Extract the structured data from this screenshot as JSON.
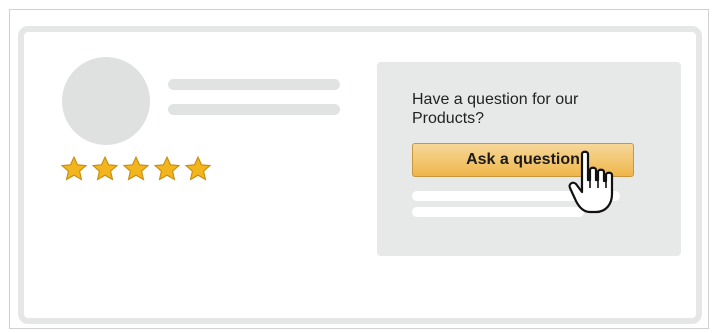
{
  "qa_panel": {
    "heading": "Have a question for our Products?",
    "ask_button_label": "Ask a question"
  },
  "rating": {
    "stars_filled": 5,
    "stars_total": 5,
    "star_color": "#f2b51d",
    "star_outline": "#c98f10"
  },
  "colors": {
    "button_top": "#f7d79a",
    "button_bottom": "#efb64a",
    "placeholder": "#e1e3e3",
    "panel_bg": "#e7e9e9"
  },
  "icons": {
    "cursor": "hand-pointer-icon",
    "star": "star-icon"
  }
}
